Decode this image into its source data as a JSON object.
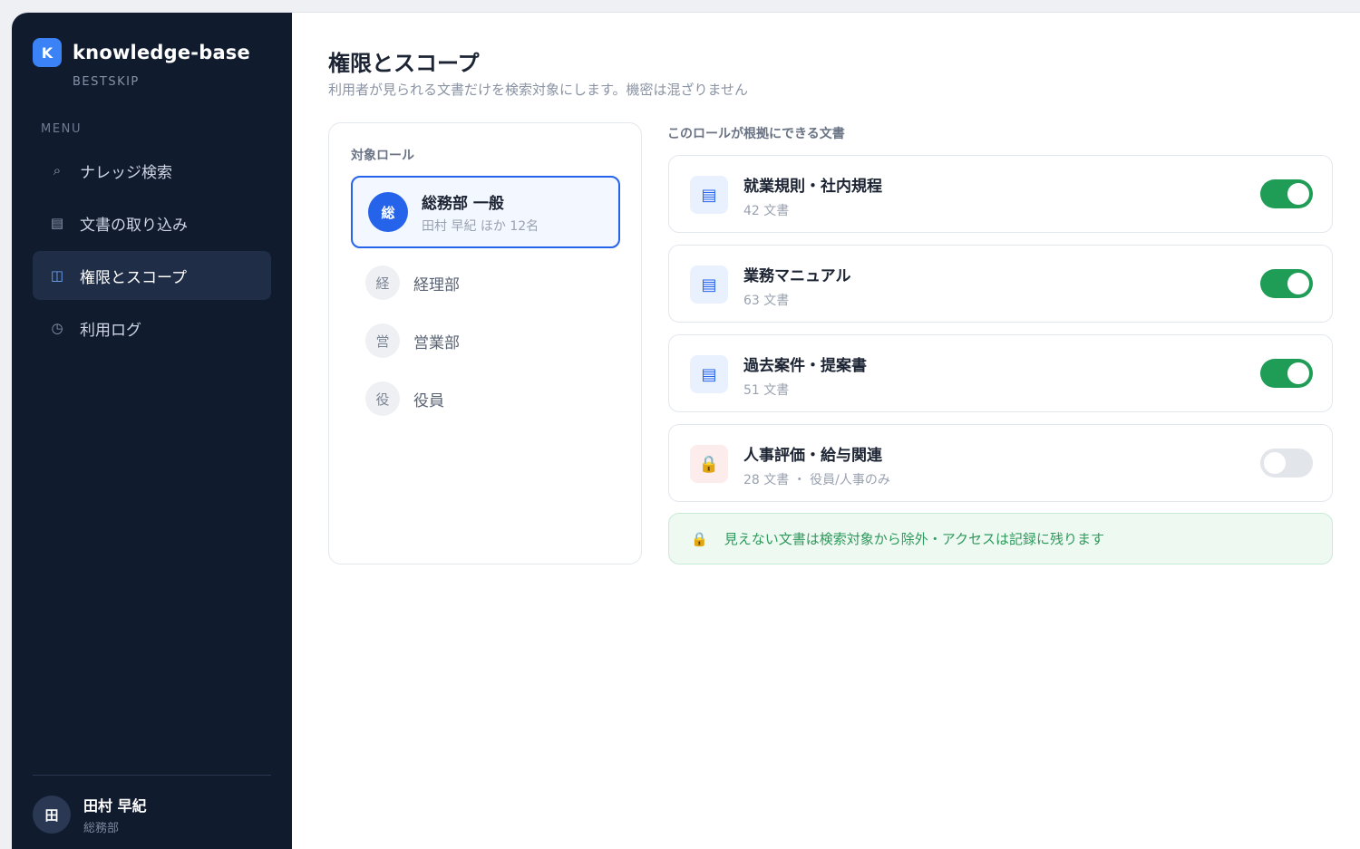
{
  "brand": {
    "logo_letter": "K",
    "name": "knowledge-base",
    "sub": "BESTSKIP"
  },
  "menu": {
    "label": "MENU",
    "items": [
      {
        "label": "ナレッジ検索",
        "icon": "search-icon",
        "glyph": "⌕"
      },
      {
        "label": "文書の取り込み",
        "icon": "document-list-icon",
        "glyph": "▤"
      },
      {
        "label": "権限とスコープ",
        "icon": "columns-icon",
        "glyph": "◫"
      },
      {
        "label": "利用ログ",
        "icon": "clock-icon",
        "glyph": "◷"
      }
    ],
    "active_index": 2
  },
  "user": {
    "avatar": "田",
    "name": "田村 早紀",
    "dept": "総務部"
  },
  "page": {
    "title": "権限とスコープ",
    "subtitle": "利用者が見られる文書だけを検索対象にします。機密は混ざりません"
  },
  "roles": {
    "title": "対象ロール",
    "items": [
      {
        "avatar": "総",
        "name": "総務部 一般",
        "meta": "田村 早紀 ほか 12名",
        "selected": true
      },
      {
        "avatar": "経",
        "name": "経理部"
      },
      {
        "avatar": "営",
        "name": "営業部"
      },
      {
        "avatar": "役",
        "name": "役員"
      }
    ]
  },
  "docs": {
    "title": "このロールが根拠にできる文書",
    "items": [
      {
        "name": "就業規則・社内規程",
        "meta": "42 文書",
        "icon": "document-icon",
        "glyph": "▤",
        "enabled": true
      },
      {
        "name": "業務マニュアル",
        "meta": "63 文書",
        "icon": "document-icon",
        "glyph": "▤",
        "enabled": true
      },
      {
        "name": "過去案件・提案書",
        "meta": "51 文書",
        "icon": "document-icon",
        "glyph": "▤",
        "enabled": true
      },
      {
        "name": "人事評価・給与関連",
        "meta": "28 文書 ・ 役員/人事のみ",
        "icon": "lock-icon",
        "glyph": "🔒",
        "enabled": false
      }
    ]
  },
  "notice": {
    "icon": "lock-icon",
    "glyph": "🔒",
    "text": "見えない文書は検索対象から除外・アクセスは記録に残ります"
  },
  "colors": {
    "sidebar": "#111b2e",
    "accent": "#2563eb",
    "toggle_on": "#1f9d57",
    "toggle_off": "#e2e5ea",
    "notice_text": "#2f9a5c"
  }
}
